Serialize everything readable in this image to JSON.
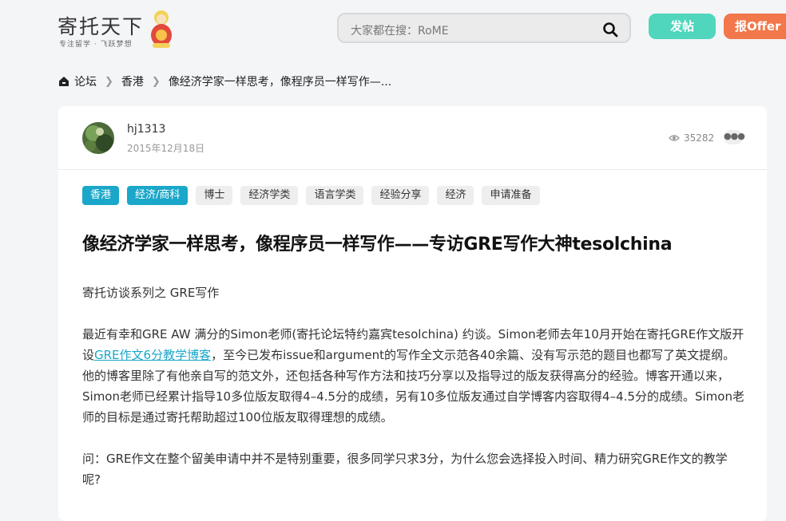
{
  "header": {
    "logo_text": "寄托天下",
    "logo_sub": "专注留学 · 飞跃梦想",
    "search_placeholder": "大家都在搜：RoME",
    "post_button": "发帖",
    "offer_button": "报Offer"
  },
  "breadcrumb": {
    "home": "论坛",
    "section": "香港",
    "current": "像经济学家一样思考，像程序员一样写作—..."
  },
  "post": {
    "author": "hj1313",
    "date": "2015年12月18日",
    "views": "35282",
    "tags": [
      "香港",
      "经济/商科",
      "博士",
      "经济学类",
      "语言学类",
      "经验分享",
      "经济",
      "申请准备"
    ],
    "title": "像经济学家一样思考，像程序员一样写作——专访GRE写作大神tesolchina",
    "para1": "寄托访谈系列之 GRE写作",
    "para2_before": "最近有幸和GRE AW 满分的Simon老师(寄托论坛特约嘉宾tesolchina) 约谈。Simon老师去年10月开始在寄托GRE作文版开设",
    "para2_link": "GRE作文6分教学博客",
    "para2_after": "，至今已发布issue和argument的写作全文示范各40余篇、没有写示范的题目也都写了英文提纲。他的博客里除了有他亲自写的范文外，还包括各种写作方法和技巧分享以及指导过的版友获得高分的经验。博客开通以来，Simon老师已经累计指导10多位版友取得4–4.5分的成绩，另有10多位版友通过自学博客内容取得4–4.5分的成绩。Simon老师的目标是通过寄托帮助超过100位版友取得理想的成绩。",
    "para3": "问：GRE作文在整个留美申请中并不是特别重要，很多同学只求3分，为什么您会选择投入时间、精力研究GRE作文的教学呢?"
  },
  "colors": {
    "accent_teal": "#1aa7c9",
    "post_button": "#4fd6bd",
    "offer_button": "#f2774a"
  }
}
